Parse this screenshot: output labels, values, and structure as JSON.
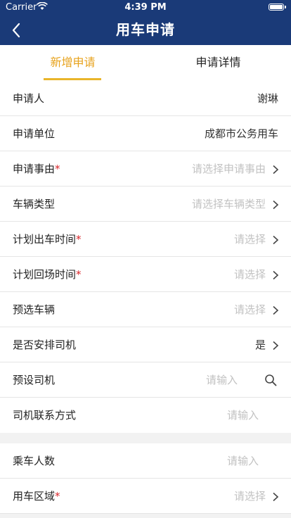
{
  "status_bar": {
    "carrier": "Carrier",
    "time": "4:39 PM"
  },
  "nav": {
    "title": "用车申请"
  },
  "tabs": [
    {
      "label": "新增申请",
      "active": true
    },
    {
      "label": "申请详情",
      "active": false
    }
  ],
  "form_section_1": [
    {
      "label": "申请人",
      "required": false,
      "value": "谢琳"
    },
    {
      "label": "申请单位",
      "required": false,
      "value": "成都市公务用车"
    },
    {
      "label": "申请事由",
      "required": true,
      "placeholder": "请选择申请事由"
    },
    {
      "label": "车辆类型",
      "required": false,
      "placeholder": "请选择车辆类型"
    },
    {
      "label": "计划出车时间",
      "required": true,
      "placeholder": "请选择"
    },
    {
      "label": "计划回场时间",
      "required": true,
      "placeholder": "请选择"
    },
    {
      "label": "预选车辆",
      "required": false,
      "placeholder": "请选择"
    },
    {
      "label": "是否安排司机",
      "required": false,
      "value": "是"
    },
    {
      "label": "预设司机",
      "required": false,
      "placeholder": "请输入"
    },
    {
      "label": "司机联系方式",
      "required": false,
      "placeholder": "请输入"
    }
  ],
  "form_section_2": [
    {
      "label": "乘车人数",
      "required": false,
      "placeholder": "请输入"
    },
    {
      "label": "用车区域",
      "required": true,
      "placeholder": "请选择"
    }
  ],
  "required_mark": "*",
  "colors": {
    "nav_bg": "#1a3a78",
    "tab_active": "#e7a21b",
    "required": "#d9262b",
    "placeholder": "#c2c2c2"
  }
}
